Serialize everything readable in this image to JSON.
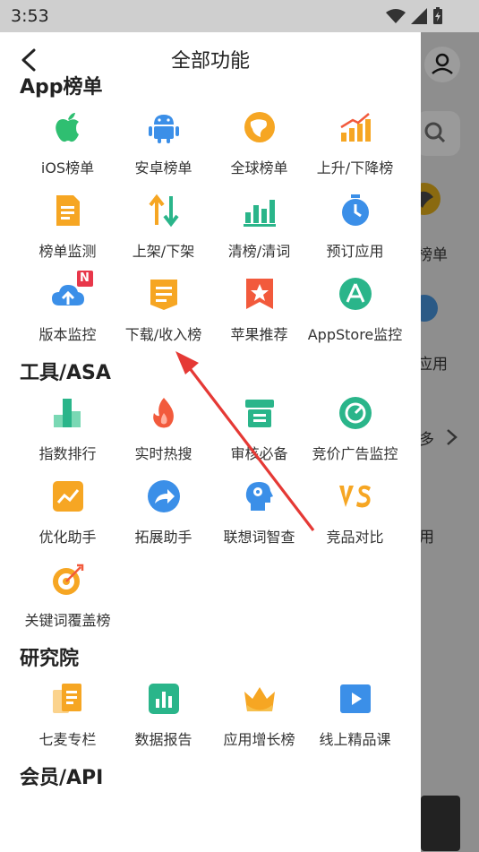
{
  "status_bar": {
    "time": "3:53"
  },
  "header": {
    "title": "全部功能"
  },
  "sections": [
    {
      "title": "App榜单",
      "items": [
        {
          "label": "iOS榜单",
          "icon": "apple-icon"
        },
        {
          "label": "安卓榜单",
          "icon": "android-icon"
        },
        {
          "label": "全球榜单",
          "icon": "globe-icon"
        },
        {
          "label": "上升/下降榜",
          "icon": "rising-bars-icon"
        },
        {
          "label": "榜单监测",
          "icon": "document-icon"
        },
        {
          "label": "上架/下架",
          "icon": "up-down-arrows-icon"
        },
        {
          "label": "清榜/清词",
          "icon": "bar-chart-icon"
        },
        {
          "label": "预订应用",
          "icon": "alarm-clock-icon"
        },
        {
          "label": "版本监控",
          "icon": "cloud-upload-icon"
        },
        {
          "label": "下载/收入榜",
          "icon": "list-doc-icon"
        },
        {
          "label": "苹果推荐",
          "icon": "star-badge-icon"
        },
        {
          "label": "AppStore监控",
          "icon": "appstore-icon"
        }
      ]
    },
    {
      "title": "工具/ASA",
      "items": [
        {
          "label": "指数排行",
          "icon": "index-bars-icon"
        },
        {
          "label": "实时热搜",
          "icon": "flame-icon"
        },
        {
          "label": "审核必备",
          "icon": "archive-icon"
        },
        {
          "label": "竞价广告监控",
          "icon": "target-circle-icon"
        },
        {
          "label": "优化助手",
          "icon": "trend-line-icon"
        },
        {
          "label": "拓展助手",
          "icon": "share-arrow-icon"
        },
        {
          "label": "联想词智查",
          "icon": "head-brain-icon"
        },
        {
          "label": "竞品对比",
          "icon": "vs-icon"
        },
        {
          "label": "关键词覆盖榜",
          "icon": "dart-target-icon"
        }
      ]
    },
    {
      "title": "研究院",
      "items": [
        {
          "label": "七麦专栏",
          "icon": "column-doc-icon"
        },
        {
          "label": "数据报告",
          "icon": "report-chart-icon"
        },
        {
          "label": "应用增长榜",
          "icon": "crown-icon"
        },
        {
          "label": "线上精品课",
          "icon": "play-video-icon"
        }
      ]
    },
    {
      "title": "会员/API",
      "items": []
    }
  ],
  "badge": {
    "text": "N"
  },
  "background_app": {
    "texts": [
      "榜单",
      "应用",
      "多",
      "用"
    ]
  },
  "colors": {
    "apple": "#2fbf71",
    "android": "#3b8fe8",
    "orange": "#f6a623",
    "red": "#f25a3c",
    "teal": "#2ab58a",
    "blue": "#3b8fe8",
    "badge": "#e8374a"
  }
}
